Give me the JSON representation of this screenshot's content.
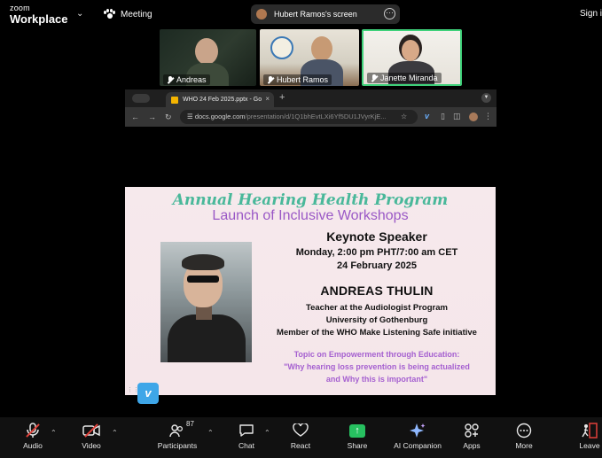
{
  "app": {
    "logo_line1": "zoom",
    "logo_line2": "Workplace",
    "meeting_label": "Meeting",
    "sign_in": "Sign in"
  },
  "screen_share": {
    "label": "Hubert Ramos's screen",
    "more": "···"
  },
  "participants_strip": [
    {
      "name": "Andreas"
    },
    {
      "name": "Hubert Ramos"
    },
    {
      "name": "Janette Miranda"
    }
  ],
  "browser": {
    "tab_title": "WHO 24 Feb 2025.pptx - Go",
    "tab_close": "×",
    "new_tab": "+",
    "url_main": "docs.google.com",
    "url_rest": "/presentation/d/1Q1bhEvtLXi6Yf5DU1JVyrKjE...",
    "back": "←",
    "forward": "→",
    "reload": "↻",
    "star": "☆"
  },
  "slide": {
    "title1": "Annual Hearing Health Program",
    "title2": "Launch of Inclusive Workshops",
    "keynote": "Keynote Speaker",
    "date_line1": "Monday, 2:00 pm PHT/7:00 am CET",
    "date_line2": "24 February 2025",
    "speaker_name": "ANDREAS THULIN",
    "aff1": "Teacher at the Audiologist Program",
    "aff2": "University of Gothenburg",
    "aff3": "Member of the WHO Make Listening Safe initiative",
    "topic": "Topic on Empowerment through Education:",
    "quote1": "\"Why hearing loss prevention is being actualized",
    "quote2": "and Why this is important\""
  },
  "toolbar": {
    "audio": "Audio",
    "video": "Video",
    "participants": "Participants",
    "participants_count": "87",
    "chat": "Chat",
    "react": "React",
    "share": "Share",
    "ai_companion": "AI Companion",
    "apps": "Apps",
    "more": "More",
    "leave": "Leave"
  },
  "colors": {
    "accent_green": "#27c060",
    "active_speaker_border": "#3fd17a",
    "slide_title_green": "#49b89a",
    "slide_title_purple": "#9a58c6",
    "leave_red": "#e0413a"
  }
}
